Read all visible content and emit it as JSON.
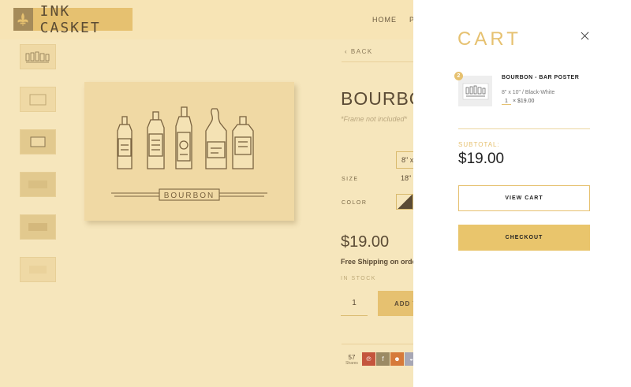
{
  "header": {
    "logo_text": "INK CASKET",
    "nav": [
      "HOME",
      "P"
    ]
  },
  "product": {
    "back_label": "BACK",
    "title": "BOURBO",
    "frame_note": "*Frame not included*",
    "size_option_visible": "8\" x",
    "size_label": "SIZE",
    "size_value": "18\"",
    "color_label": "COLOR",
    "poster_label": "BOURBON",
    "price": "$19.00",
    "shipping": "Free Shipping on orde",
    "stock": "IN STOCK",
    "quantity": "1",
    "add_button": "ADD T",
    "share_count": "57",
    "share_label": "Shares",
    "share_buttons": [
      {
        "icon": "pinterest-icon",
        "glyph": "℗",
        "color": "#c4553d"
      },
      {
        "icon": "facebook-icon",
        "glyph": "f",
        "color": "#9b8a64"
      },
      {
        "icon": "reddit-icon",
        "glyph": "☻",
        "color": "#d67a3a"
      },
      {
        "icon": "messenger-icon",
        "glyph": "◒",
        "color": "#a7a7b5"
      }
    ]
  },
  "cart": {
    "title": "CART",
    "item": {
      "badge": "2",
      "name": "BOURBON - BAR POSTER",
      "variant": "8\" x 10\" / Black-White",
      "quantity": "1",
      "price": "× $19.00"
    },
    "subtotal_label": "SUBTOTAL:",
    "subtotal_value": "$19.00",
    "view_cart": "VIEW CART",
    "checkout": "CHECKOUT"
  },
  "colors": {
    "accent": "#e6c170",
    "overlay": "#f6e6bc",
    "ink": "#5b4b35"
  }
}
